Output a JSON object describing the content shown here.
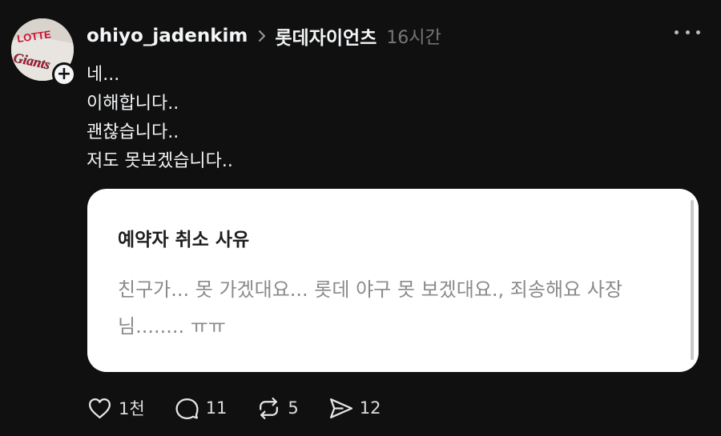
{
  "post": {
    "username": "ohiyo_jadenkim",
    "community": "롯데자이언츠",
    "time": "16시간",
    "lines": [
      "네...",
      "이해합니다..",
      "괜찮습니다..",
      "저도 못보겠습니다.."
    ]
  },
  "card": {
    "title": "예약자 취소 사유",
    "body": "친구가... 못 가겠대요... 롯데 야구 못 보겠대요., 죄송해요 사장님........ ㅠㅠ"
  },
  "actions": {
    "likes": "1천",
    "comments": "11",
    "reposts": "5",
    "shares": "12"
  },
  "avatar": {
    "logo_text_1": "LOTTE",
    "logo_text_2": "Giants"
  },
  "colors": {
    "background": "#101010",
    "text": "#f3f5f7",
    "muted": "#777777",
    "card": "#ffffff",
    "brand_red": "#c8102e"
  },
  "icons": [
    "chevron-right-icon",
    "more-icon",
    "plus-icon",
    "heart-icon",
    "comment-icon",
    "repost-icon",
    "share-icon"
  ]
}
